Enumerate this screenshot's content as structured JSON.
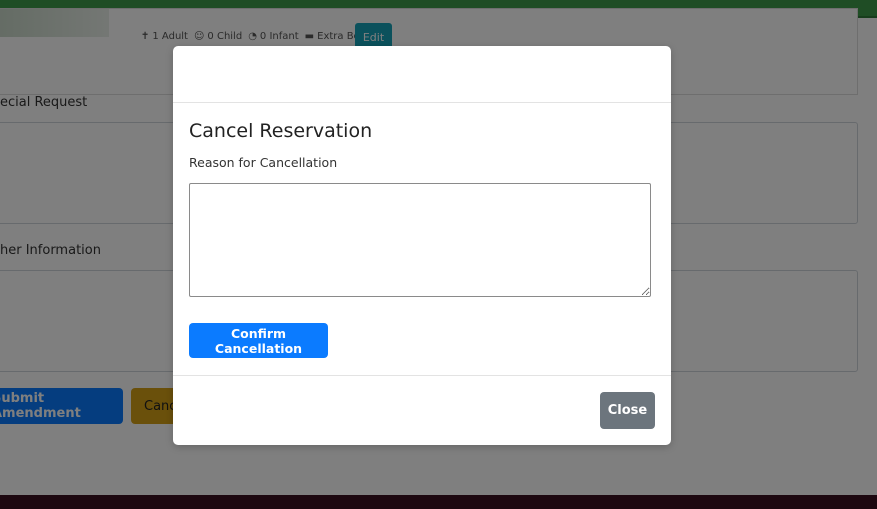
{
  "background": {
    "occupancy": {
      "adult": "1 Adult",
      "child": "0 Child",
      "infant": "0 Infant",
      "extra_bed": "Extra Bed"
    },
    "edit_label": "Edit",
    "special_request_label": "ecial Request",
    "other_info_label": "her Information",
    "submit_label": "Submit Amendment",
    "cancel_label": "Canc"
  },
  "modal": {
    "title": "Cancel Reservation",
    "reason_label": "Reason for Cancellation",
    "reason_value": "",
    "confirm_label": "Confirm Cancellation",
    "close_label": "Close"
  },
  "colors": {
    "primary": "#0b7bff",
    "secondary": "#6c757d",
    "info": "#17a2b8",
    "warning": "#d4a017",
    "header": "#3f9a4a"
  }
}
